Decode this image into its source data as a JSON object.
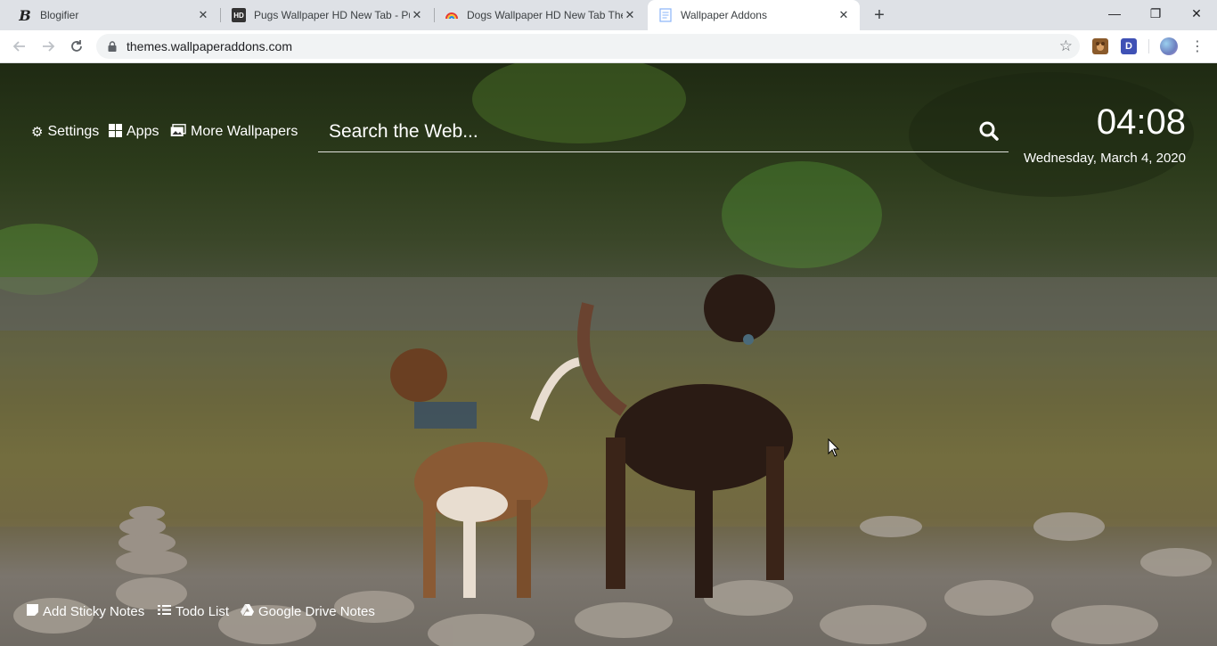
{
  "browser": {
    "tabs": [
      {
        "title": "Blogifier",
        "favicon": "blogifier-logo",
        "active": false
      },
      {
        "title": "Pugs Wallpaper HD New Tab - Pu",
        "favicon": "hd-icon",
        "active": false
      },
      {
        "title": "Dogs Wallpaper HD New Tab The",
        "favicon": "rainbow-icon",
        "active": false
      },
      {
        "title": "Wallpaper Addons",
        "favicon": "document-icon",
        "active": true
      }
    ],
    "new_tab": "+",
    "window_controls": {
      "minimize": "—",
      "restore": "❐",
      "close": "✕"
    },
    "url": "themes.wallpaperaddons.com",
    "extensions": [
      {
        "icon": "dog-extension-icon",
        "color": "#8a5a2b"
      },
      {
        "label": "D",
        "color": "#3f51b5"
      }
    ]
  },
  "page": {
    "nav": {
      "settings": "Settings",
      "apps": "Apps",
      "more_wallpapers": "More Wallpapers"
    },
    "search": {
      "placeholder": "Search the Web..."
    },
    "clock": {
      "time": "04:08",
      "date": "Wednesday, March 4, 2020"
    },
    "bottom": {
      "sticky_notes": "Add Sticky Notes",
      "todo_list": "Todo List",
      "drive_notes": "Google Drive Notes"
    }
  }
}
